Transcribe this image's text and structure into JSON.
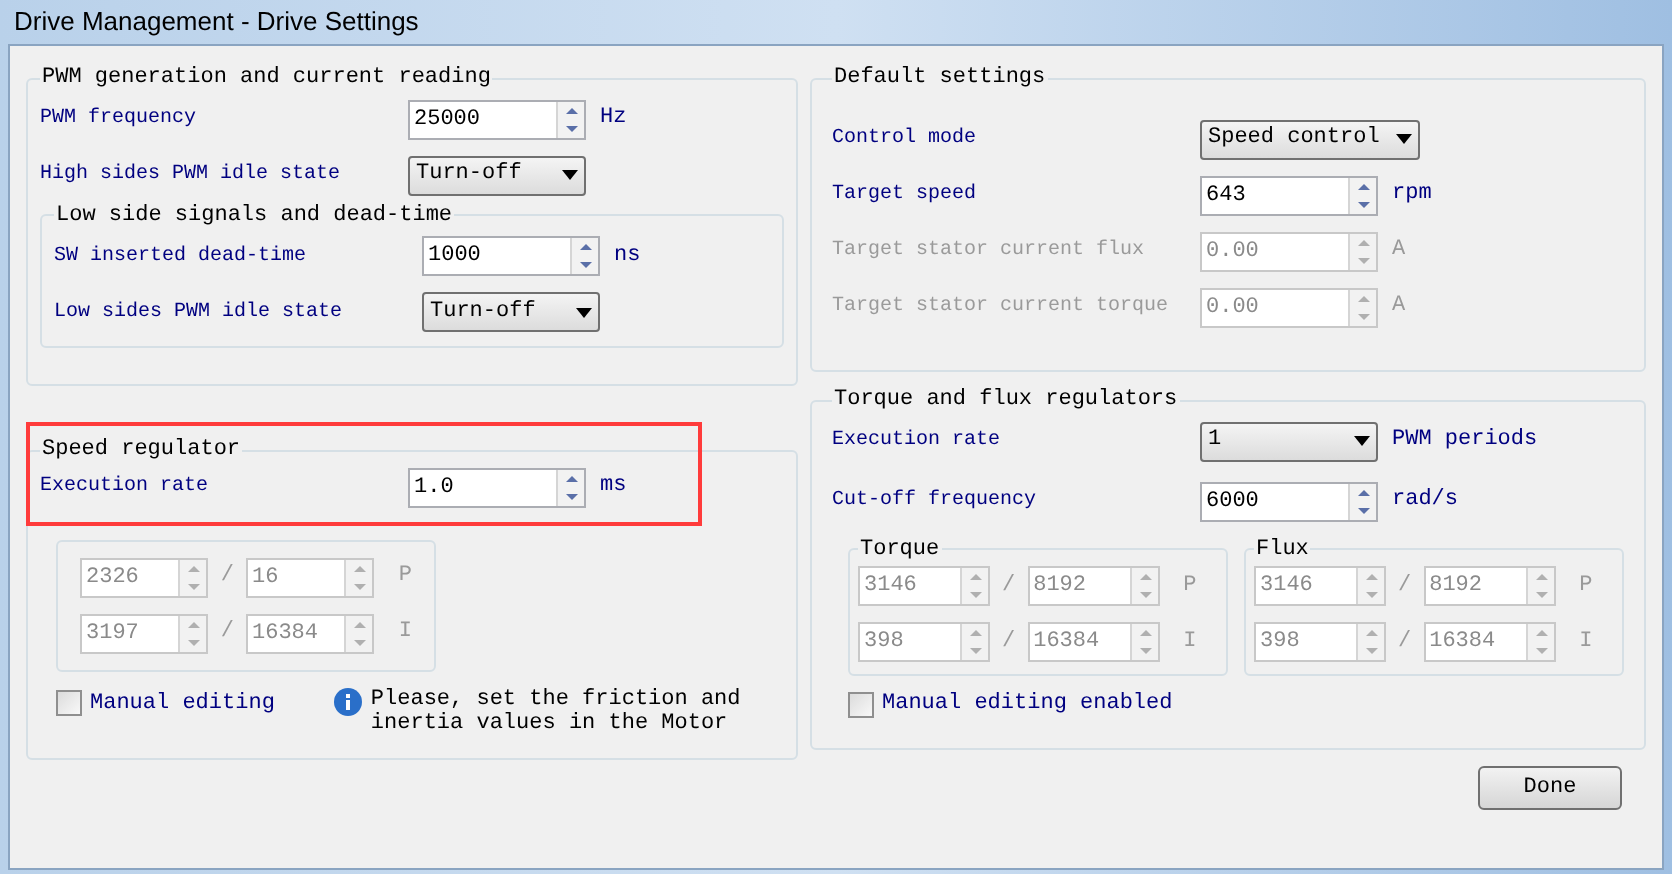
{
  "window": {
    "title": "Drive Management - Drive Settings"
  },
  "pwm_group": {
    "title": "PWM generation and current reading",
    "rows": [
      {
        "kind": "spin",
        "label": "PWM frequency",
        "value": "25000",
        "unit": "Hz",
        "disabled": false
      },
      {
        "kind": "combo",
        "label": "High sides PWM idle state",
        "value": "Turn-off",
        "disabled": false
      }
    ],
    "low_side_group": {
      "title": "Low side signals and dead-time",
      "rows": [
        {
          "kind": "spin",
          "label": "SW inserted dead-time",
          "value": "1000",
          "unit": "ns",
          "disabled": false
        },
        {
          "kind": "combo",
          "label": "Low sides PWM idle state",
          "value": "Turn-off",
          "disabled": false
        }
      ]
    }
  },
  "speed_regulator": {
    "title": "Speed regulator",
    "highlighted": true,
    "rows": [
      {
        "kind": "spin",
        "label": "Execution rate",
        "value": "1.0",
        "unit": "ms",
        "disabled": false
      }
    ],
    "gains": {
      "disabled": true,
      "rows": [
        {
          "numerator": "2326",
          "separator": "/",
          "denominator": "16",
          "label": "P"
        },
        {
          "numerator": "3197",
          "separator": "/",
          "denominator": "16384",
          "label": "I"
        }
      ]
    },
    "manual_editing": {
      "label": "Manual editing",
      "checked": false
    },
    "info": "Please, set the friction and\ninertia values in the Motor"
  },
  "default_settings": {
    "title": "Default settings",
    "rows": [
      {
        "kind": "combo",
        "label": "Control mode",
        "value": "Speed control",
        "disabled": false
      },
      {
        "kind": "spin",
        "label": "Target speed",
        "value": "643",
        "unit": "rpm",
        "disabled": false
      },
      {
        "kind": "spin",
        "label": "Target stator current flux",
        "value": "0.00",
        "unit": "A",
        "disabled": true
      },
      {
        "kind": "spin",
        "label": "Target stator current torque",
        "value": "0.00",
        "unit": "A",
        "disabled": true
      }
    ]
  },
  "torque_flux": {
    "title": "Torque and flux regulators",
    "rows": [
      {
        "kind": "combo",
        "label": "Execution rate",
        "value": "1",
        "unit": "PWM periods",
        "disabled": false
      },
      {
        "kind": "spin",
        "label": "Cut-off frequency",
        "value": "6000",
        "unit": "rad/s",
        "disabled": false
      }
    ],
    "subgroups": [
      {
        "title": "Torque",
        "disabled": true,
        "rows": [
          {
            "numerator": "3146",
            "separator": "/",
            "denominator": "8192",
            "label": "P"
          },
          {
            "numerator": "398",
            "separator": "/",
            "denominator": "16384",
            "label": "I"
          }
        ]
      },
      {
        "title": "Flux",
        "disabled": true,
        "rows": [
          {
            "numerator": "3146",
            "separator": "/",
            "denominator": "8192",
            "label": "P"
          },
          {
            "numerator": "398",
            "separator": "/",
            "denominator": "16384",
            "label": "I"
          }
        ]
      }
    ],
    "manual_editing": {
      "label": "Manual editing enabled",
      "checked": false
    }
  },
  "buttons": [
    {
      "label": "Done"
    }
  ]
}
